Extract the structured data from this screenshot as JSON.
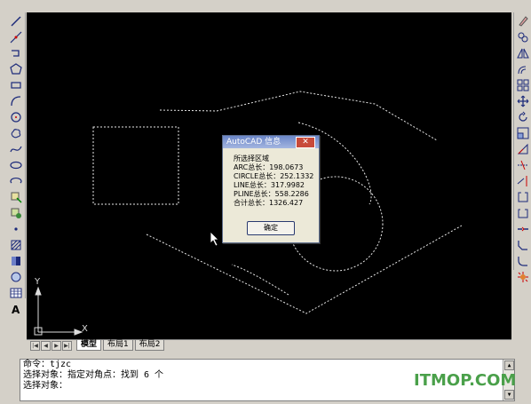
{
  "tabs": {
    "model": "模型",
    "layout1": "布局1",
    "layout2": "布局2"
  },
  "dialog": {
    "title": "AutoCAD 信息",
    "close": "✕",
    "lines": [
      "所选择区域",
      "ARC总长：198.0673",
      "CIRCLE总长：252.1332",
      "LINE总长：317.9982",
      "PLINE总长：558.2286",
      "合计总长：1326.427"
    ],
    "ok": "确定"
  },
  "command": {
    "lines": [
      "命令：tjzc",
      "选择对象：指定对角点：找到 6 个",
      "选择对象："
    ]
  },
  "ucs": {
    "x": "X",
    "y": "Y"
  },
  "watermark": "ITMOP.COM",
  "icons": {
    "left": [
      "line-icon",
      "construction-line-icon",
      "polyline-icon",
      "polygon-icon",
      "rectangle-icon",
      "arc-icon",
      "circle-icon",
      "revcloud-icon",
      "spline-icon",
      "ellipse-icon",
      "ellipse-arc-icon",
      "insert-block-icon",
      "make-block-icon",
      "point-icon",
      "hatch-icon",
      "gradient-icon",
      "region-icon",
      "table-icon",
      "multiline-text-icon"
    ],
    "right": [
      "erase-icon",
      "copy-icon",
      "mirror-icon",
      "offset-icon",
      "array-icon",
      "move-icon",
      "rotate-icon",
      "scale-icon",
      "stretch-icon",
      "trim-icon",
      "extend-icon",
      "break-at-point-icon",
      "break-icon",
      "join-icon",
      "chamfer-icon",
      "fillet-icon",
      "explode-icon"
    ]
  },
  "colors": {
    "canvas": "#000000",
    "toolbar": "#d4d0c8",
    "watermark": "#4aa04a"
  }
}
